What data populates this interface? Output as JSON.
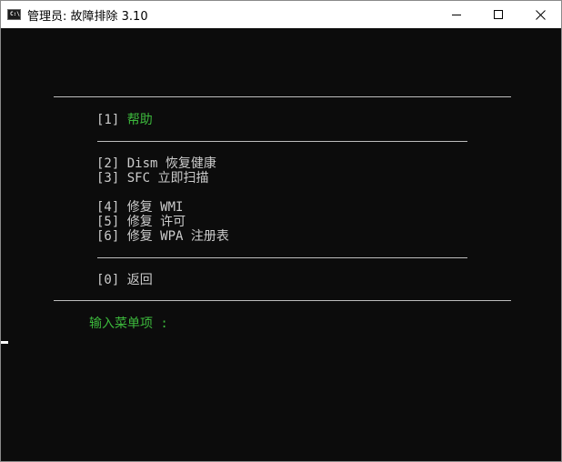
{
  "window": {
    "title": "管理员:  故障排除 3.10",
    "icon": "cmd-icon",
    "controls": [
      "minimize-icon",
      "maximize-icon",
      "close-icon"
    ]
  },
  "console": {
    "menu": [
      {
        "key": "[1]",
        "label": "帮助"
      },
      {
        "key": "[2]",
        "label": "Dism 恢复健康"
      },
      {
        "key": "[3]",
        "label": "SFC 立即扫描"
      },
      {
        "key": "[4]",
        "label": "修复 WMI"
      },
      {
        "key": "[5]",
        "label": "修复 许可"
      },
      {
        "key": "[6]",
        "label": "修复 WPA 注册表"
      },
      {
        "key": "[0]",
        "label": "返回"
      }
    ],
    "prompt": "输入菜单项 :"
  },
  "colors": {
    "background": "#0c0c0c",
    "text": "#cccccc",
    "accent": "#3cb83c",
    "titlebar": "#ffffff"
  }
}
